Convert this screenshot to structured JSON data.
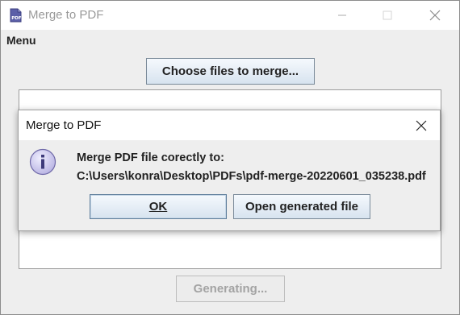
{
  "window": {
    "title": "Merge to PDF",
    "icon": "pdf-icon",
    "controls": [
      "minimize-icon",
      "maximize-icon",
      "close-icon"
    ]
  },
  "menubar": {
    "menu_label": "Menu"
  },
  "main": {
    "choose_button_label": "Choose files to merge...",
    "generate_button_label": "Generating..."
  },
  "dialog": {
    "title": "Merge to PDF",
    "icon": "info-icon",
    "message_line1": "Merge PDF file corectly to:",
    "message_line2": "C:\\Users\\konra\\Desktop\\PDFs\\pdf-merge-20220601_035238.pdf",
    "ok_label": "OK",
    "open_label": "Open generated file"
  },
  "colors": {
    "button_gradient_top": "#f5f9fd",
    "button_gradient_bottom": "#d7e3ef",
    "info_icon_fill": "#c8c4ec"
  }
}
